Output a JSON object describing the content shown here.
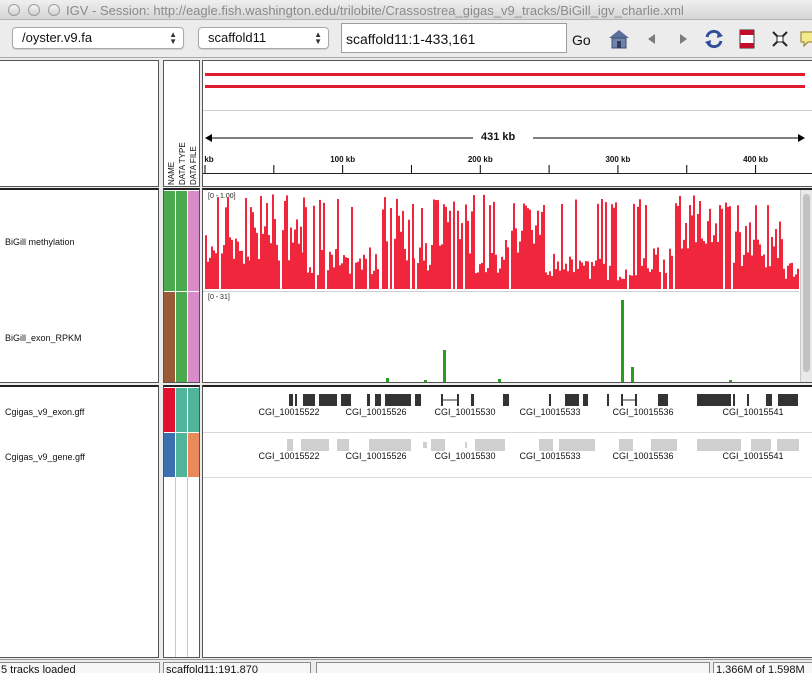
{
  "window": {
    "title": "IGV - Session: http://eagle.fish.washington.edu/trilobite/Crassostrea_gigas_v9_tracks/BiGill_igv_charlie.xml"
  },
  "toolbar": {
    "genome": "/oyster.v9.fa",
    "chromosome": "scaffold11",
    "locus": "scaffold11:1-433,161",
    "go_label": "Go",
    "icons": [
      "home-icon",
      "back-icon",
      "forward-icon",
      "refresh-icon",
      "region-of-interest-icon",
      "resize-icon",
      "popup-text-icon"
    ]
  },
  "header": {
    "attribute_columns": [
      "NAME",
      "DATA TYPE",
      "DATA FILE"
    ],
    "ruler_span": "431 kb",
    "ruler_ticks": [
      "kb",
      "100 kb",
      "200 kb",
      "300 kb",
      "400 kb"
    ],
    "ruler_tick_positions_kb": [
      0,
      100,
      200,
      300,
      400
    ]
  },
  "colors": {
    "methylation": "#f0263c",
    "rpkm": "#2a9d1f",
    "gene_features": "#333333",
    "attr_green": "#4aaa4d",
    "attr_brown": "#9a5a35",
    "attr_pink": "#d98ac8",
    "attr_red": "#e0102e",
    "attr_blue": "#3a6fb0",
    "attr_teal": "#4fb49a",
    "attr_orange": "#e88a5a"
  },
  "data_tracks": [
    {
      "name": "BiGill methylation",
      "range": "[0 - 1.00]"
    },
    {
      "name": "BiGill_exon_RPKM",
      "range": "[0 - 31]"
    }
  ],
  "feature_tracks": [
    {
      "name": "Cgigas_v9_exon.gff",
      "genes": [
        "CGI_10015522",
        "CGI_10015526",
        "CGI_10015530",
        "CGI_10015533",
        "CGI_10015536",
        "CGI_10015541"
      ]
    },
    {
      "name": "Cgigas_v9_gene.gff",
      "genes": [
        "CGI_10015522",
        "CGI_10015526",
        "CGI_10015530",
        "CGI_10015533",
        "CGI_10015536",
        "CGI_10015541"
      ]
    }
  ],
  "status": {
    "tracks_loaded": "5 tracks loaded",
    "position": "scaffold11:191,870",
    "memory": "1,366M of 1,598M"
  }
}
